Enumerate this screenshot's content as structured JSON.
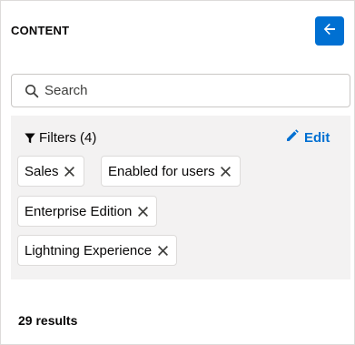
{
  "panel": {
    "title": "CONTENT",
    "back_icon": "arrow-left-icon"
  },
  "search": {
    "placeholder": "Search",
    "value": "",
    "icon": "search-icon"
  },
  "filters": {
    "label": "Filters (4)",
    "edit_label": "Edit",
    "pills": [
      {
        "label": "Sales"
      },
      {
        "label": "Enabled for users"
      },
      {
        "label": "Enterprise Edition"
      },
      {
        "label": "Lightning Experience"
      }
    ]
  },
  "results": {
    "count_label": "29 results"
  },
  "colors": {
    "brand": "#0070d2",
    "filter_bg": "#f3f2f2",
    "text": "#080707"
  }
}
